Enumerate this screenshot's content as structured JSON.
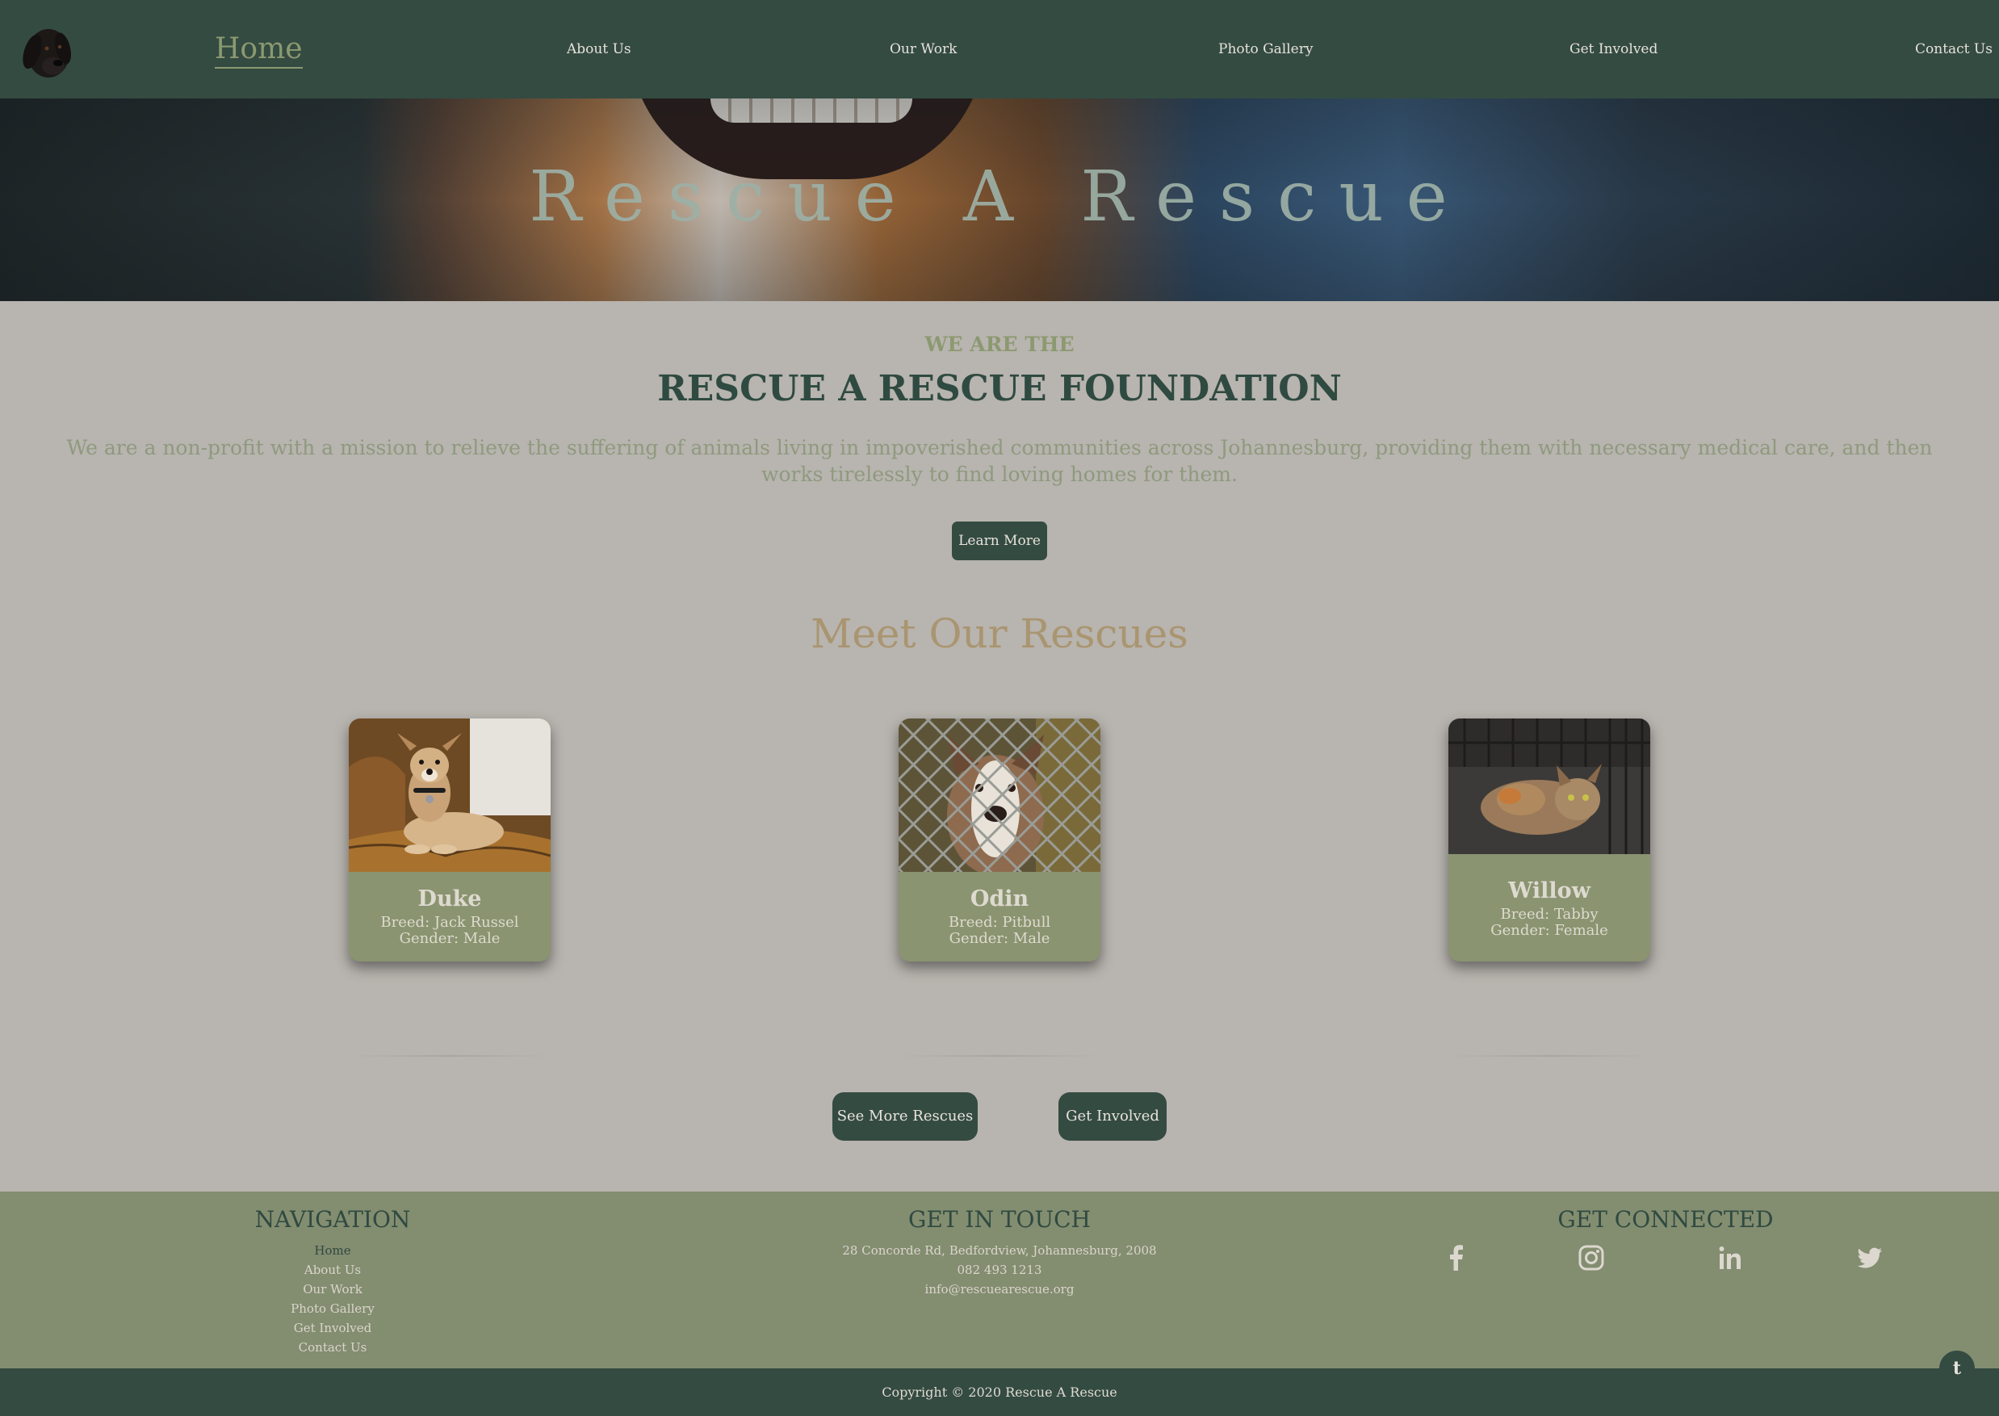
{
  "nav": {
    "home": "Home",
    "items": [
      "About Us",
      "Our Work",
      "Photo Gallery",
      "Get Involved",
      "Contact Us"
    ]
  },
  "hero": {
    "title": "Rescue A Rescue"
  },
  "intro": {
    "eyebrow": "WE ARE THE",
    "title": "RESCUE A RESCUE FOUNDATION",
    "mission": "We are a non-profit with a mission to relieve the suffering of animals living in impoverished communities across Johannesburg, providing them with necessary medical care, and then works tirelessly to find loving homes for them.",
    "cta": "Learn More"
  },
  "rescues": {
    "heading": "Meet Our Rescues",
    "cards": [
      {
        "name": "Duke",
        "breed": "Breed: Jack Russel",
        "gender": "Gender: Male"
      },
      {
        "name": "Odin",
        "breed": "Breed: Pitbull",
        "gender": "Gender: Male"
      },
      {
        "name": "Willow",
        "breed": "Breed: Tabby",
        "gender": "Gender: Female"
      }
    ],
    "see_more": "See More Rescues",
    "get_involved": "Get Involved"
  },
  "footer": {
    "nav_heading": "NAVIGATION",
    "nav_items": [
      "Home",
      "About Us",
      "Our Work",
      "Photo Gallery",
      "Get Involved",
      "Contact Us"
    ],
    "touch_heading": "GET IN TOUCH",
    "address": "28 Concorde Rd, Bedfordview, Johannesburg, 2008",
    "phone": "082 493 1213",
    "email": "info@rescuearescue.org",
    "connected_heading": "GET CONNECTED",
    "social_icons": [
      "facebook-icon",
      "instagram-icon",
      "linkedin-icon",
      "twitter-icon"
    ],
    "copyright": "Copyright © 2020 Rescue A Rescue",
    "back_to_top": "t"
  },
  "colors": {
    "nav_bg": "#344b42",
    "page_bg": "#b8b4af",
    "accent_green": "#8c9970",
    "heading_dark": "#2f4a41",
    "accent_tan": "#a99570",
    "footer_bg": "#838d70"
  }
}
